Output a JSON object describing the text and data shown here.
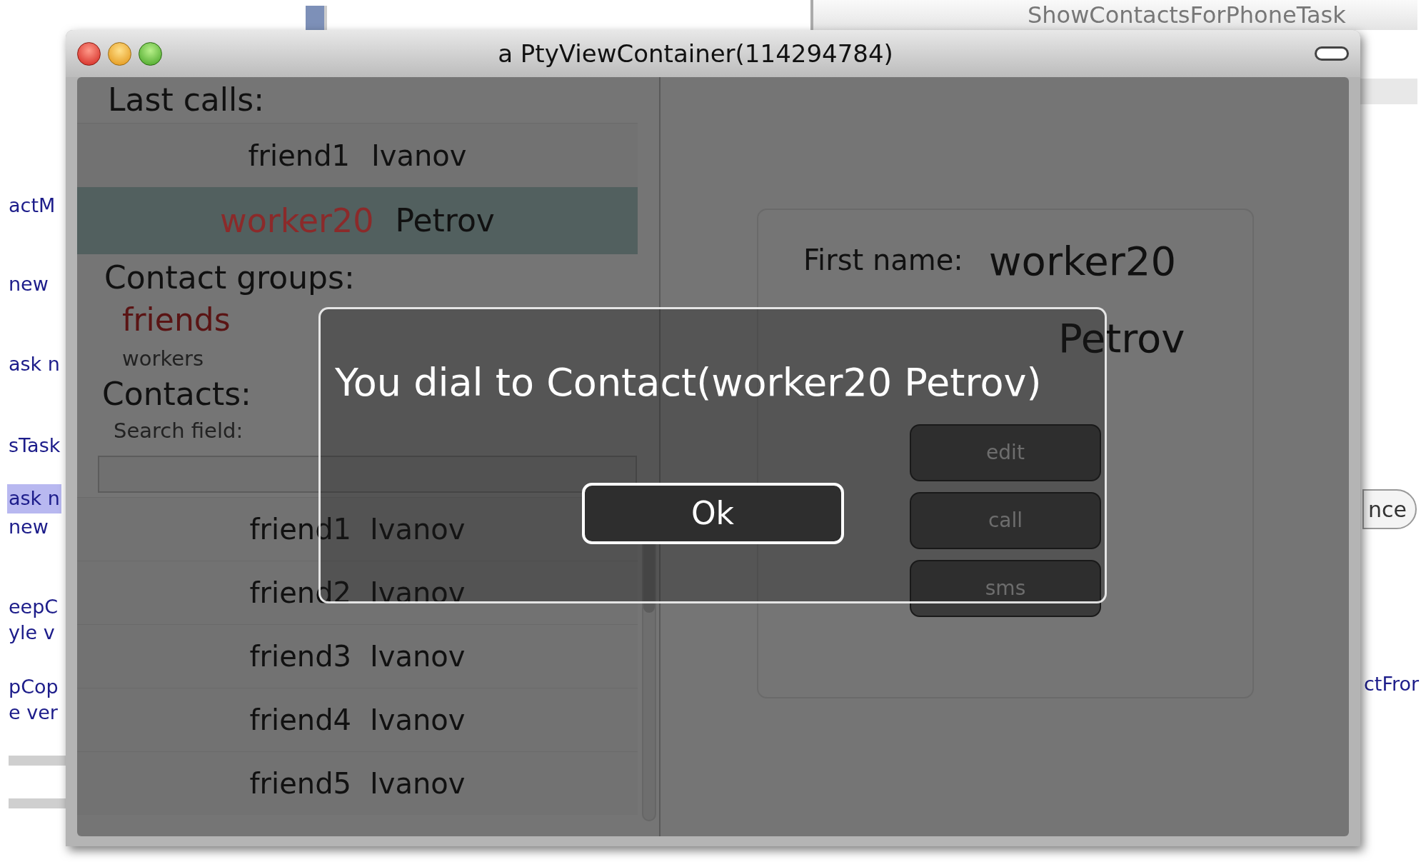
{
  "background_app": {
    "tab_title": "ShowContactsForPhoneTask",
    "left_fragments": [
      {
        "text": "actM",
        "selected": false
      },
      {
        "text": "new",
        "selected": false
      },
      {
        "text": "ask n",
        "selected": false
      },
      {
        "text": "sTask",
        "selected": false
      },
      {
        "text": "ask n",
        "selected": true
      },
      {
        "text": "new",
        "selected": false
      },
      {
        "text": "eepC",
        "selected": false
      },
      {
        "text": "yle v",
        "selected": false
      },
      {
        "text": "pCop",
        "selected": false
      },
      {
        "text": "e ver",
        "selected": false
      }
    ],
    "button_fragment": "nce",
    "right_fragment": "ctFror"
  },
  "window": {
    "title": "a PtyViewContainer(114294784)"
  },
  "last_calls": {
    "heading": "Last calls:",
    "items": [
      {
        "first": "friend1",
        "last": "Ivanov",
        "selected": false
      },
      {
        "first": "worker20",
        "last": "Petrov",
        "selected": true
      }
    ]
  },
  "contact_groups": {
    "heading": "Contact groups:",
    "items": [
      {
        "label": "friends",
        "selected": true
      },
      {
        "label": "workers",
        "selected": false
      }
    ]
  },
  "contacts": {
    "heading": "Contacts:",
    "search_label": "Search field:",
    "items": [
      {
        "first": "friend1",
        "last": "Ivanov"
      },
      {
        "first": "friend2",
        "last": "Ivanov"
      },
      {
        "first": "friend3",
        "last": "Ivanov"
      },
      {
        "first": "friend4",
        "last": "Ivanov"
      },
      {
        "first": "friend5",
        "last": "Ivanov"
      }
    ]
  },
  "details": {
    "first_name_label": "First name:",
    "first_name": "worker20",
    "last_name": "Petrov",
    "buttons": [
      "edit",
      "call",
      "sms"
    ]
  },
  "dialog": {
    "message": "You dial to Contact(worker20 Petrov)",
    "button": "Ok"
  }
}
